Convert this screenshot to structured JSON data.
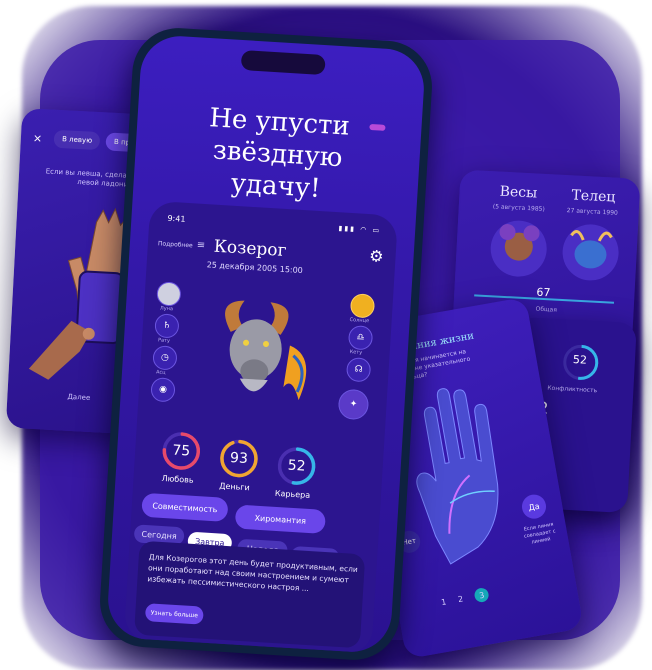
{
  "headline": [
    "Не упусти",
    "звёздную",
    "удачу!"
  ],
  "status": {
    "time": "9:41"
  },
  "header": {
    "menu_label": "Подробнее",
    "sign": "Козерог",
    "birth": "25 декабря 2005 15:00"
  },
  "planets": {
    "moon": "Луна",
    "sun": "Солнце",
    "saturn": "Рату",
    "ketu": "Кету",
    "asc": "Асц"
  },
  "rings": [
    {
      "label": "Любовь",
      "value": "75",
      "fraction": 0.75,
      "color": "#e84a6a"
    },
    {
      "label": "Деньги",
      "value": "93",
      "fraction": 0.93,
      "color": "#f1a531"
    },
    {
      "label": "Карьера",
      "value": "52",
      "fraction": 0.52,
      "color": "#36b6e8"
    }
  ],
  "buttons": {
    "compat": "Совместимость",
    "palm": "Хиромантия"
  },
  "days": [
    "Сегодня",
    "Завтра",
    "Неделя",
    "Месяц"
  ],
  "forecast": {
    "text": "Для Козерогов этот день будет продуктивным, если они поработают над своим настроением и сумеют избежать пессимистического настроя ...",
    "more": "Узнать больше"
  },
  "left_card": {
    "close": "×",
    "tab_left": "В левую",
    "tab_right": "В правую",
    "hint": "Если вы левша, сделайте фото левой ладони",
    "next": "Далее"
  },
  "right_top": {
    "sign_a": "Весы",
    "date_a": "(5 августа 1985)",
    "sign_b": "Телец",
    "date_b": "27 августа 1990",
    "score": "67",
    "score_label": "Общая"
  },
  "right_bottom": {
    "title": "Линия жизни",
    "sub": "Линия начинается на уровне указательного пальца?",
    "yes": "Да",
    "yes_note": "Если линия совпадает с линией",
    "no": "Нет",
    "steps": [
      "1",
      "2",
      "3"
    ]
  },
  "far_right": {
    "score": "52",
    "label": "Конфликтность",
    "score2": "2"
  },
  "colors": {
    "bg": "#3b1aa8",
    "accent": "#6a46ea",
    "love": "#e84a6a",
    "money": "#f1a531",
    "career": "#36b6e8"
  }
}
